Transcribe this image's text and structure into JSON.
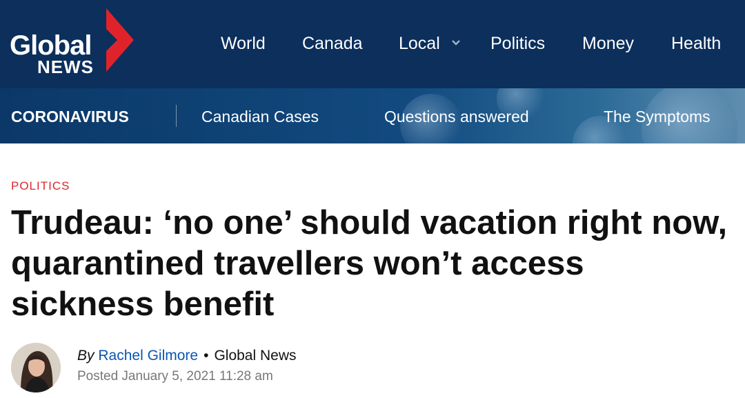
{
  "brand": {
    "logo_top": "Global",
    "logo_bottom": "NEWS",
    "colors": {
      "navy": "#0c2f5c",
      "red": "#e0232b",
      "link_blue": "#0b55b0"
    }
  },
  "main_nav": {
    "items": [
      "World",
      "Canada",
      "Local",
      "Politics",
      "Money",
      "Health"
    ],
    "local_dropdown_icon": "chevron-down-icon"
  },
  "sub_nav": {
    "section": "CORONAVIRUS",
    "items": [
      "Canadian Cases",
      "Questions answered",
      "The Symptoms"
    ]
  },
  "article": {
    "category": "POLITICS",
    "headline": "Trudeau: ‘no one’ should vacation right now, quarantined travellers won’t access sickness benefit",
    "byline_prefix": "By",
    "author": "Rachel Gilmore",
    "separator": "•",
    "source": "Global News",
    "posted": "Posted January 5, 2021 11:28 am"
  }
}
